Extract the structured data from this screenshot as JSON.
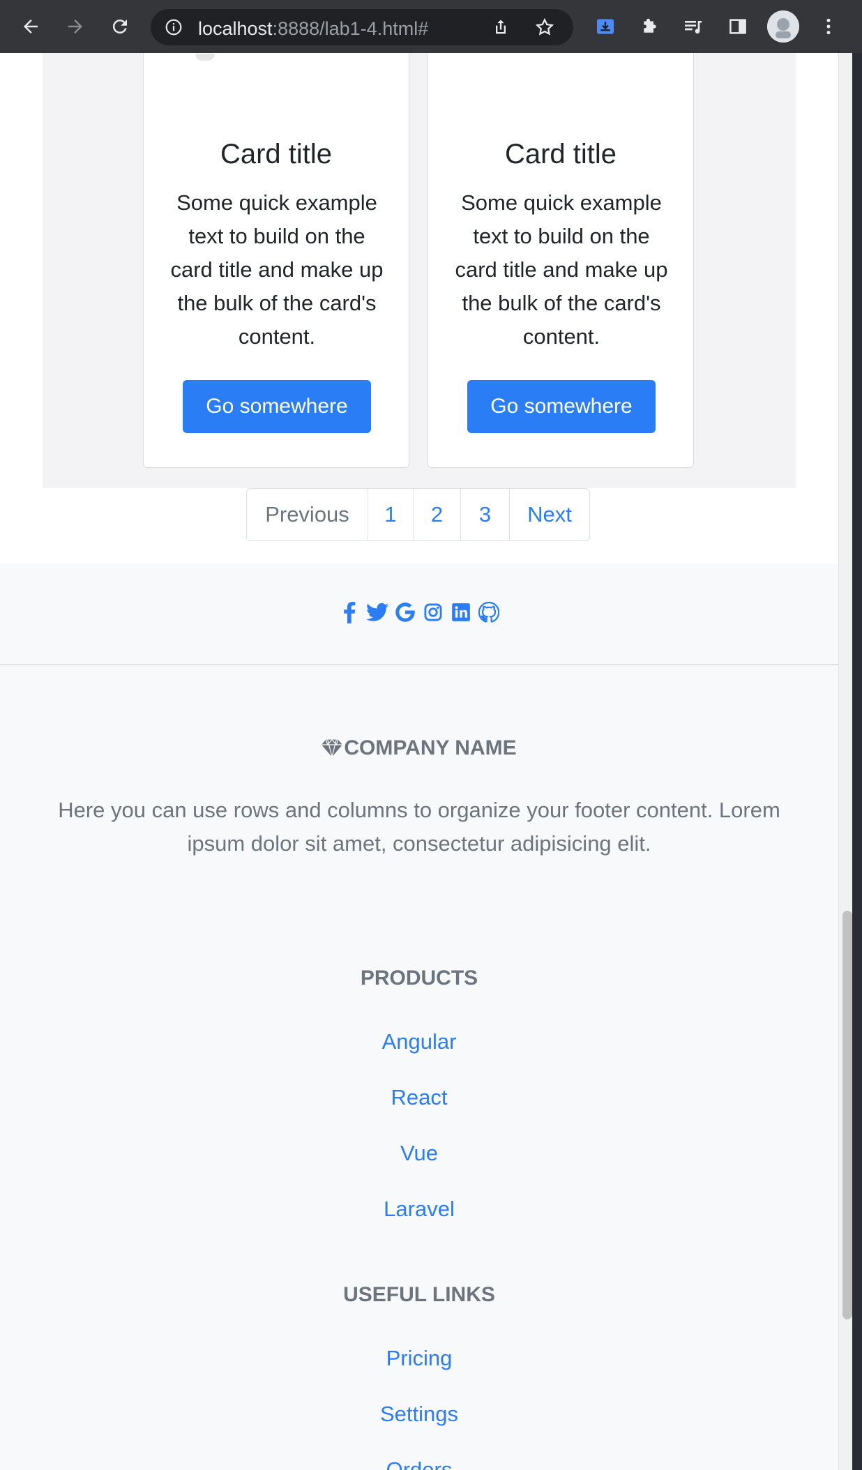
{
  "browser": {
    "url_host": "localhost",
    "url_rest": ":8888/lab1-4.html#"
  },
  "cards": [
    {
      "title": "Card title",
      "text": "Some quick example text to build on the card title and make up the bulk of the card's content.",
      "button": "Go somewhere"
    },
    {
      "title": "Card title",
      "text": "Some quick example text to build on the card title and make up the bulk of the card's content.",
      "button": "Go somewhere"
    }
  ],
  "pagination": {
    "previous": "Previous",
    "pages": [
      "1",
      "2",
      "3"
    ],
    "next": "Next"
  },
  "footer": {
    "social_icons": [
      "facebook-icon",
      "twitter-icon",
      "google-icon",
      "instagram-icon",
      "linkedin-icon",
      "github-icon"
    ],
    "company_name": "COMPANY NAME",
    "description": "Here you can use rows and columns to organize your footer content. Lorem ipsum dolor sit amet, consectetur adipisicing elit.",
    "products_heading": "PRODUCTS",
    "products": [
      "Angular",
      "React",
      "Vue",
      "Laravel"
    ],
    "useful_heading": "USEFUL LINKS",
    "useful": [
      "Pricing",
      "Settings",
      "Orders"
    ]
  },
  "colors": {
    "accent": "#2b7df5",
    "muted": "#6c757d",
    "footer_bg": "#f8f9fa"
  }
}
